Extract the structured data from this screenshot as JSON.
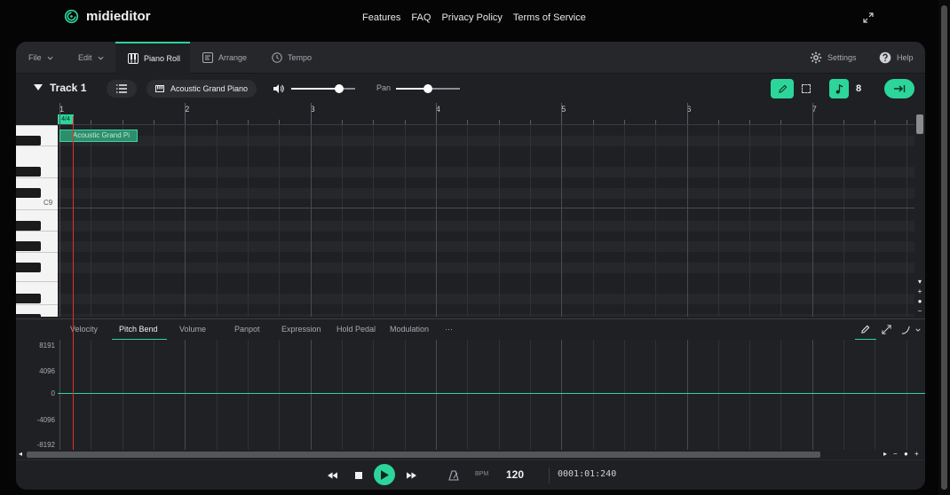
{
  "site": {
    "brand": "midieditor",
    "nav": [
      "Features",
      "FAQ",
      "Privacy Policy",
      "Terms of Service"
    ]
  },
  "menubar": {
    "file": "File",
    "edit": "Edit",
    "tabs": [
      {
        "label": "Piano Roll",
        "icon": "piano-icon",
        "active": true
      },
      {
        "label": "Arrange",
        "icon": "arrange-icon",
        "active": false
      },
      {
        "label": "Tempo",
        "icon": "clock-icon",
        "active": false
      }
    ],
    "settings": "Settings",
    "help": "Help"
  },
  "track": {
    "title": "Track 1",
    "instrument": "Acoustic Grand Piano",
    "pan_label": "Pan",
    "volume_level": 0.75,
    "pan_level": 0.5,
    "quantize": "8"
  },
  "ruler": {
    "bars": [
      "1",
      "2",
      "3",
      "4",
      "5",
      "6",
      "7"
    ],
    "time_signature": "4/4"
  },
  "piano": {
    "octave_label": "C9"
  },
  "note": {
    "label": "Acoustic Grand Pi"
  },
  "controls": {
    "tabs": [
      "Velocity",
      "Pitch Bend",
      "Volume",
      "Panpot",
      "Expression",
      "Hold Pedal",
      "Modulation",
      "···"
    ],
    "active": "Pitch Bend",
    "y_labels": [
      "8191",
      "4096",
      "0",
      "-4096",
      "-8192"
    ]
  },
  "transport": {
    "bpm_label": "BPM",
    "bpm": "120",
    "time": "0001:01:240"
  },
  "colors": {
    "accent": "#2cd69a",
    "playhead": "#e0312b",
    "background": "#1f2024"
  }
}
